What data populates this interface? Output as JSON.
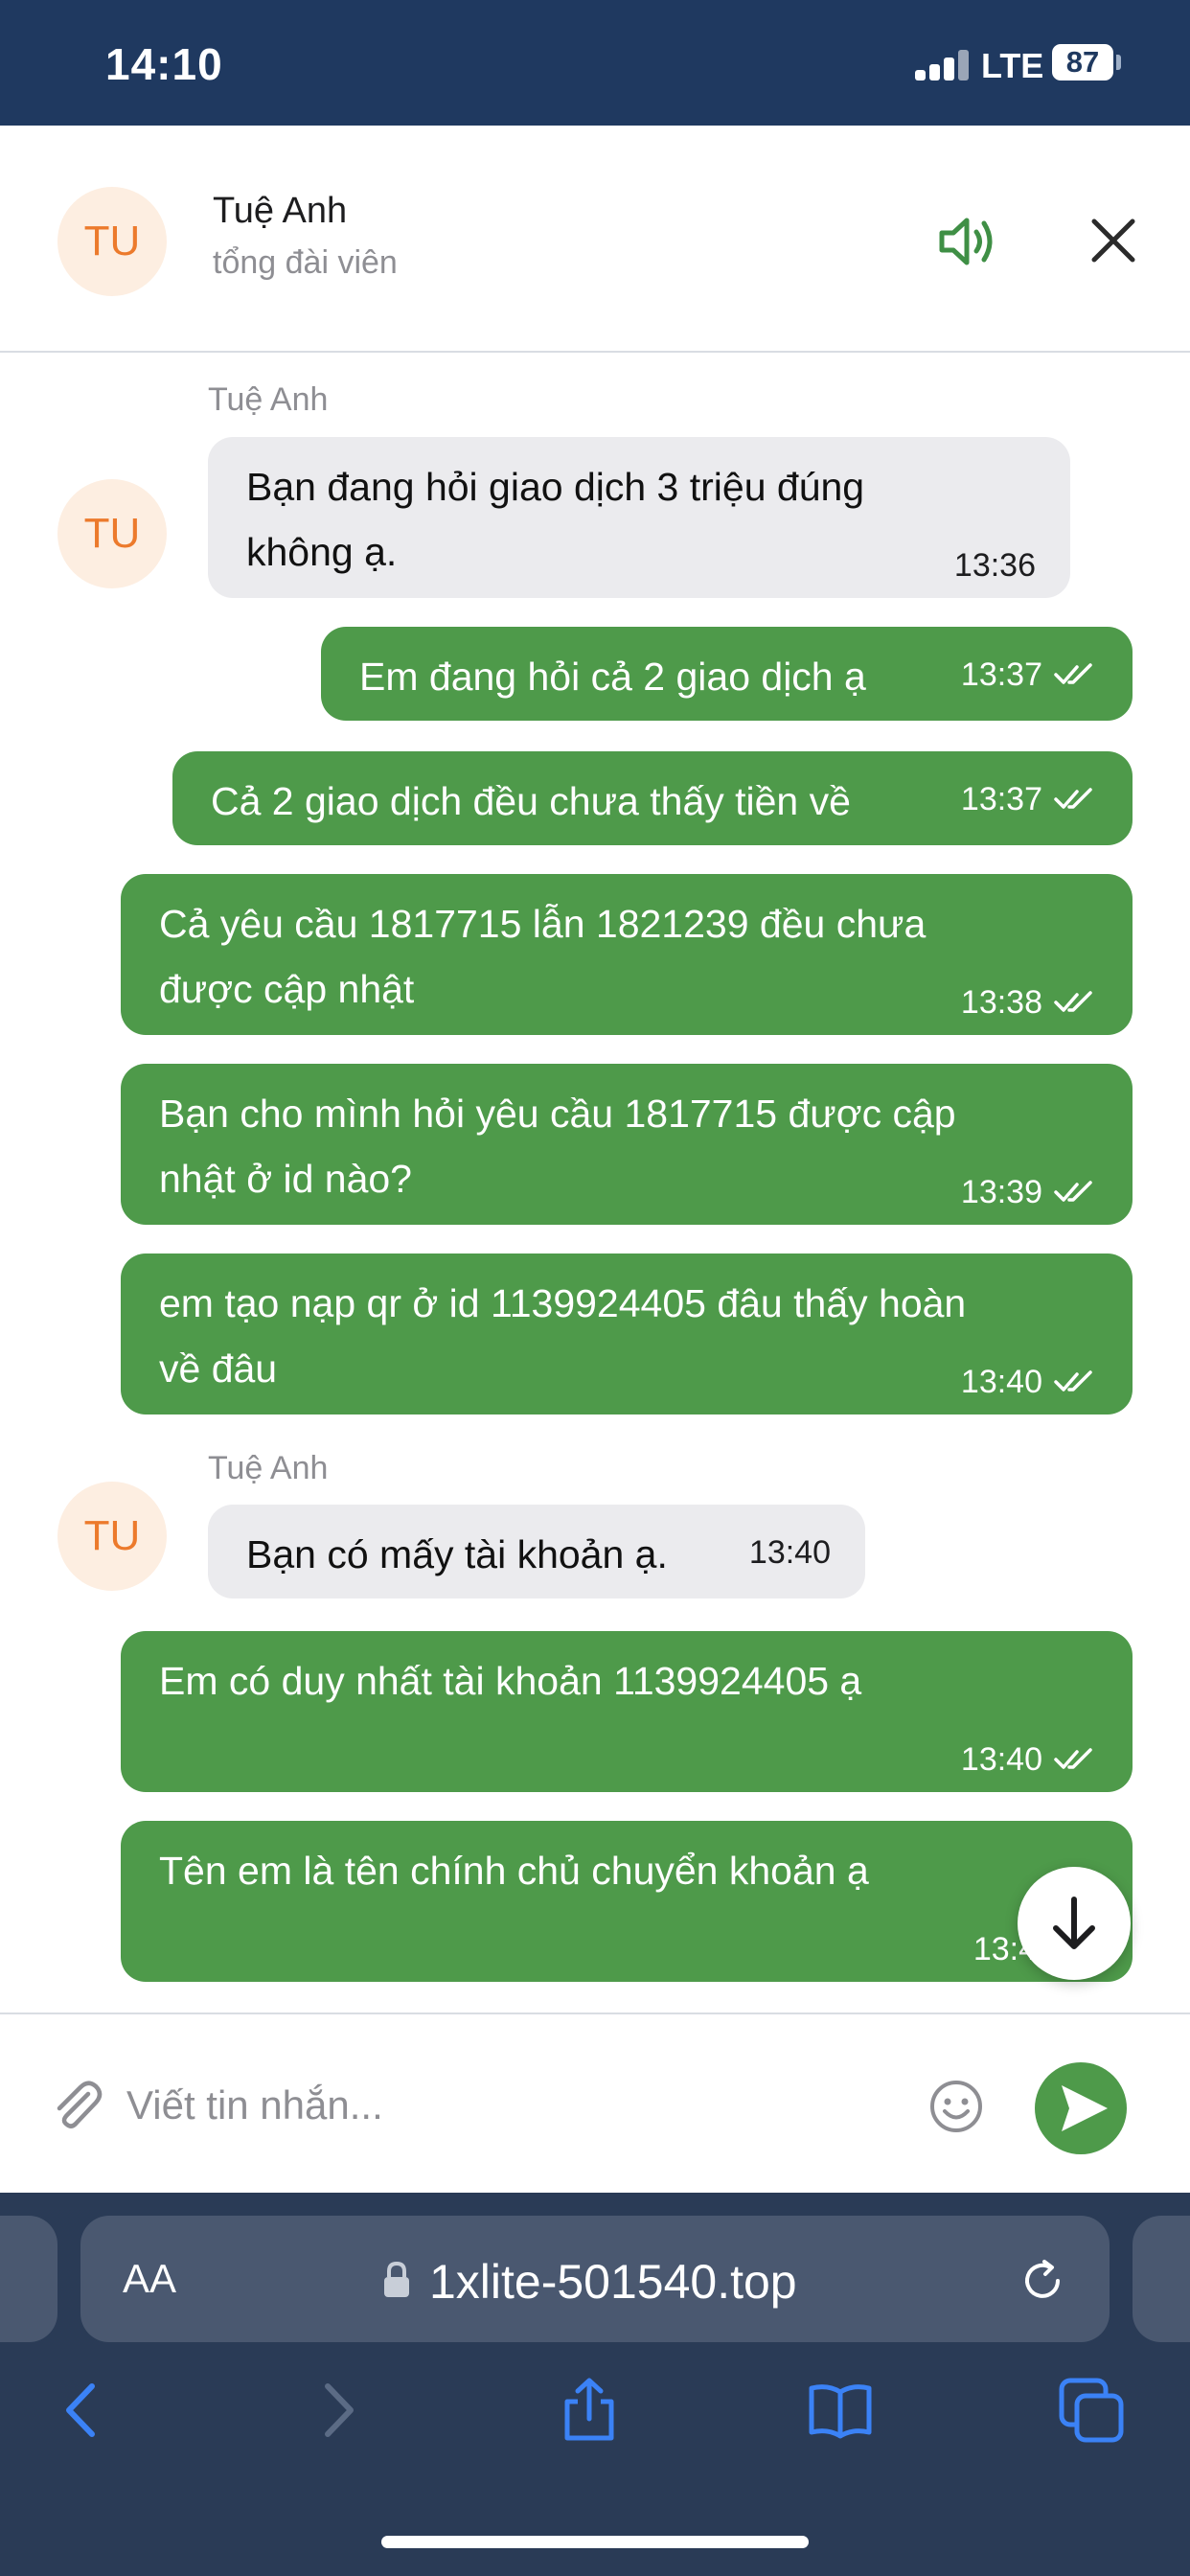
{
  "status_bar": {
    "time": "14:10",
    "network": "LTE",
    "battery": "87"
  },
  "header": {
    "avatar_initials": "TU",
    "agent_name": "Tuệ Anh",
    "agent_role": "tổng đài viên"
  },
  "messages": [
    {
      "direction": "in",
      "sender": "Tuệ Anh",
      "avatar": "TU",
      "lines": [
        "Bạn đang hỏi giao dịch 3 triệu đúng",
        "không ạ."
      ],
      "time": "13:36"
    },
    {
      "direction": "out",
      "lines": [
        "Em đang hỏi cả 2 giao dịch ạ"
      ],
      "time": "13:37"
    },
    {
      "direction": "out",
      "lines": [
        "Cả 2 giao dịch đều chưa thấy tiền về"
      ],
      "time": "13:37"
    },
    {
      "direction": "out",
      "lines": [
        "Cả yêu cầu 1817715 lẫn 1821239 đều chưa",
        "được cập nhật"
      ],
      "time": "13:38"
    },
    {
      "direction": "out",
      "lines": [
        "Bạn cho mình hỏi yêu cầu 1817715 được cập",
        "nhật ở id nào?"
      ],
      "time": "13:39"
    },
    {
      "direction": "out",
      "lines": [
        "em tạo nạp qr ở id 1139924405 đâu thấy hoàn",
        "về đâu"
      ],
      "time": "13:40"
    },
    {
      "direction": "in",
      "sender": "Tuệ Anh",
      "avatar": "TU",
      "lines": [
        "Bạn có mấy tài khoản ạ."
      ],
      "time": "13:40"
    },
    {
      "direction": "out",
      "lines": [
        "Em có duy nhất tài khoản 1139924405 ạ"
      ],
      "time": "13:40"
    },
    {
      "direction": "out",
      "lines": [
        "Tên em là tên chính chủ chuyển khoản ạ"
      ],
      "time": "13:4"
    }
  ],
  "composer": {
    "placeholder": "Viết tin nhắn..."
  },
  "browser": {
    "aa_label": "AA",
    "url": "1xlite-501540.top"
  },
  "colors": {
    "header_bg": "#1f3960",
    "outgoing": "#4e9a4a",
    "incoming": "#ebebee",
    "avatar_bg": "#fdeee1",
    "avatar_text": "#ec7a2c",
    "browser_bg": "#2a3b56",
    "browser_icons": "#3b82f6"
  },
  "icons": {
    "sound": "speaker-icon",
    "close": "close-icon",
    "read": "double-check-icon",
    "scroll": "arrow-down-icon",
    "attach": "paperclip-icon",
    "emoji": "smiley-icon",
    "send": "send-icon"
  }
}
